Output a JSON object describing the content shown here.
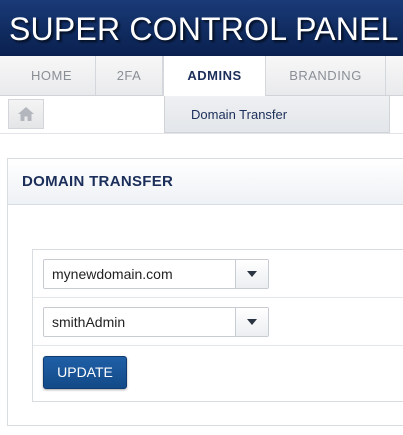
{
  "header": {
    "title": "SUPER CONTROL PANEL"
  },
  "nav": {
    "tabs": [
      {
        "label": "HOME"
      },
      {
        "label": "2FA"
      },
      {
        "label": "ADMINS",
        "active": true
      },
      {
        "label": "BRANDING"
      }
    ]
  },
  "subnav": {
    "home_icon": "home-icon",
    "items": [
      {
        "label": "Domain Transfer"
      }
    ]
  },
  "panel": {
    "title": "DOMAIN TRANSFER",
    "domain_select": {
      "value": "mynewdomain.com"
    },
    "admin_select": {
      "value": "smithAdmin"
    },
    "update_label": "UPDATE"
  },
  "colors": {
    "header_bg": "#0f2a5e",
    "accent_text": "#1b2f5a",
    "button_bg": "#134a88"
  }
}
